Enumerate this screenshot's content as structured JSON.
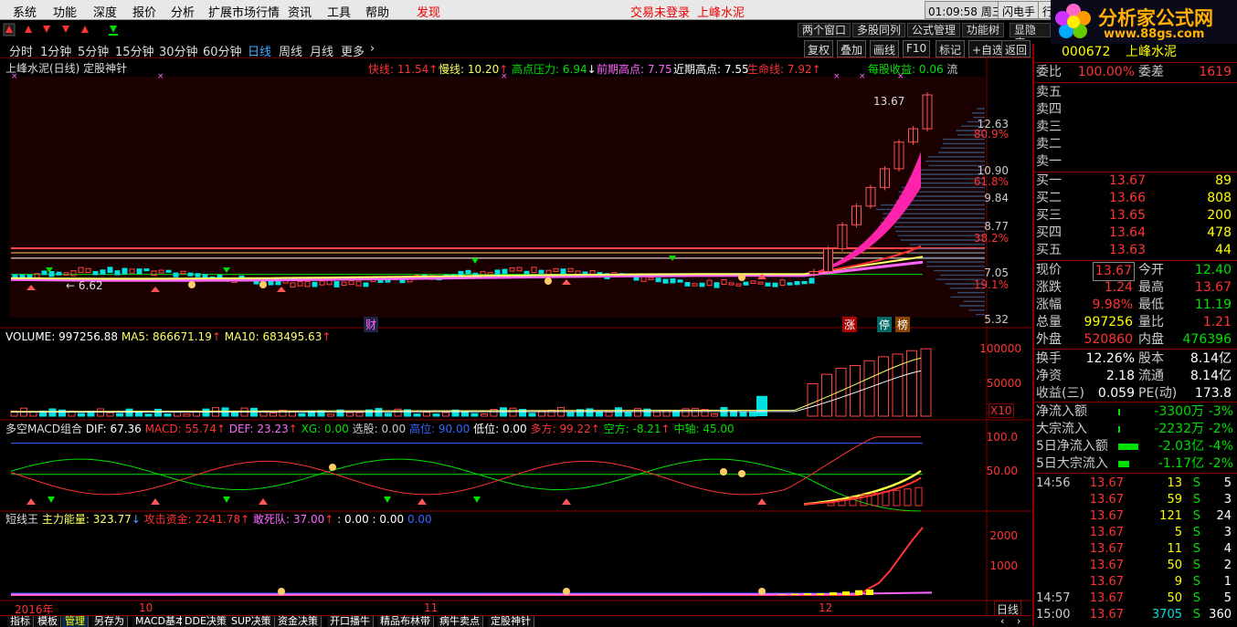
{
  "menubar": {
    "items": [
      "系统",
      "功能",
      "深度",
      "报价",
      "分析",
      "扩展市场行情",
      "资讯",
      "工具",
      "帮助"
    ],
    "discover": "发现",
    "trade_status": "交易未登录",
    "stock_name": "上峰水泥",
    "clock": "01:09:58 周三",
    "flash_order": "闪电手",
    "trade": "行"
  },
  "logo": {
    "title": "分析家公式网",
    "url": "www.88gs.com"
  },
  "toolbar2": {
    "buttons": [
      "两个窗口",
      "多股同列",
      "公式管理",
      "功能树",
      "显隐底"
    ]
  },
  "periods": {
    "items": [
      "分时",
      "1分钟",
      "5分钟",
      "15分钟",
      "30分钟",
      "60分钟",
      "日线",
      "周线",
      "月线",
      "更多"
    ],
    "active_index": 6,
    "right_buttons": [
      "复权",
      "叠加",
      "画线",
      "F10",
      "标记",
      "+自选",
      "返回"
    ]
  },
  "main_panel": {
    "title": "上峰水泥(日线) 定股神针",
    "indicators": [
      {
        "label": "快线:",
        "value": "11.54",
        "color": "#ff3333"
      },
      {
        "label": "慢线:",
        "value": "10.20",
        "color": "#ffff66"
      },
      {
        "label": "高点压力:",
        "value": "6.94",
        "color": "#00e000"
      },
      {
        "label": "前期高点:",
        "value": "7.75",
        "color": "#ff66ff"
      },
      {
        "label": "近期高点:",
        "value": "7.55",
        "color": "#ffffff"
      },
      {
        "label": "生命线:",
        "value": "7.92",
        "color": "#ff3333"
      },
      {
        "label": "每股收益:",
        "value": "0.06",
        "color": "#00e000"
      }
    ],
    "unit": "流",
    "high_label": "13.67",
    "low_label": "6.62",
    "y_ticks": [
      {
        "v": "12.63",
        "c": "#ff3333"
      },
      {
        "v": "80.9%",
        "c": "#ff3333"
      },
      {
        "v": "10.90",
        "c": "#ff3333"
      },
      {
        "v": "61.8%",
        "c": "#ff3333"
      },
      {
        "v": "9.84",
        "c": "#ff3333"
      },
      {
        "v": "8.77",
        "c": "#ff3333"
      },
      {
        "v": "38.2%",
        "c": "#ff3333"
      },
      {
        "v": "7.05",
        "c": "#ff3333"
      },
      {
        "v": "19.1%",
        "c": "#ff3333"
      },
      {
        "v": "5.32",
        "c": "#ff3333"
      }
    ],
    "markers": {
      "cai": "财",
      "zhang": "涨",
      "ting": "停",
      "ban": "榜"
    }
  },
  "volume_panel": {
    "indicators": [
      {
        "label": "VOLUME:",
        "value": "997256.88",
        "color": "#ffffff"
      },
      {
        "label": "MA5:",
        "value": "866671.19",
        "color": "#ffff66"
      },
      {
        "label": "MA10:",
        "value": "683495.63",
        "color": "#ffff66"
      }
    ],
    "y_ticks": [
      "100000",
      "50000"
    ],
    "scale": "X10"
  },
  "macd_panel": {
    "title": "多空MACD组合",
    "indicators": [
      {
        "label": "DIF:",
        "value": "67.36",
        "color": "#ffffff"
      },
      {
        "label": "MACD:",
        "value": "55.74",
        "color": "#ff3333"
      },
      {
        "label": "DEF:",
        "value": "23.23",
        "color": "#ff66ff"
      },
      {
        "label": "XG:",
        "value": "0.00",
        "color": "#00e000"
      },
      {
        "label": "选股:",
        "value": "0.00",
        "color": "#cccccc"
      },
      {
        "label": "高位:",
        "value": "90.00",
        "color": "#3366ff"
      },
      {
        "label": "低位:",
        "value": "0.00",
        "color": "#ffffff"
      },
      {
        "label": "多方:",
        "value": "99.22",
        "color": "#ff3333"
      },
      {
        "label": "空方:",
        "value": "-8.21",
        "color": "#00e000"
      },
      {
        "label": "中轴:",
        "value": "45.00",
        "color": "#00e000"
      }
    ],
    "y_ticks": [
      "100.0",
      "50.00"
    ]
  },
  "short_panel": {
    "title": "短线王",
    "indicators": [
      {
        "label": "主力能量:",
        "value": "323.77",
        "color": "#ffff66"
      },
      {
        "label": "攻击资金:",
        "value": "2241.78",
        "color": "#ff3333"
      },
      {
        "label": "敢死队:",
        "value": "37.00",
        "color": "#ff66ff"
      },
      {
        "label": ":",
        "value": "0.00 : 0.00",
        "color": "#ffffff"
      },
      {
        "label": "",
        "value": "0.00",
        "color": "#3366ff"
      }
    ],
    "y_ticks": [
      "2000",
      "1000"
    ]
  },
  "x_axis": {
    "labels": [
      "2016年",
      "10",
      "11",
      "12"
    ],
    "period": "日线"
  },
  "bottom_tabs": [
    "指标",
    "模板",
    "管理",
    "另存为",
    "MACD基本",
    "DDE决策",
    "SUP决策",
    "资金决策",
    "开口播牛",
    "精品布林带",
    "病牛卖点",
    "定股神针"
  ],
  "bottom_active": 2,
  "side": {
    "code": "000672",
    "name": "上峰水泥",
    "webi": {
      "k": "委比",
      "v": "100.00%",
      "k2": "委差",
      "v2": "1619"
    },
    "sells": [
      {
        "k": "卖五",
        "p": "",
        "q": ""
      },
      {
        "k": "卖四",
        "p": "",
        "q": ""
      },
      {
        "k": "卖三",
        "p": "",
        "q": ""
      },
      {
        "k": "卖二",
        "p": "",
        "q": ""
      },
      {
        "k": "卖一",
        "p": "",
        "q": ""
      }
    ],
    "buys": [
      {
        "k": "买一",
        "p": "13.67",
        "q": "89"
      },
      {
        "k": "买二",
        "p": "13.66",
        "q": "808"
      },
      {
        "k": "买三",
        "p": "13.65",
        "q": "200"
      },
      {
        "k": "买四",
        "p": "13.64",
        "q": "478"
      },
      {
        "k": "买五",
        "p": "13.63",
        "q": "44"
      }
    ],
    "quote": [
      {
        "k": "现价",
        "v": "13.67",
        "vc": "#ff3333",
        "k2": "今开",
        "v2": "12.40",
        "v2c": "#00e000"
      },
      {
        "k": "涨跌",
        "v": "1.24",
        "vc": "#ff3333",
        "k2": "最高",
        "v2": "13.67",
        "v2c": "#ff3333"
      },
      {
        "k": "涨幅",
        "v": "9.98%",
        "vc": "#ff3333",
        "k2": "最低",
        "v2": "11.19",
        "v2c": "#00e000"
      },
      {
        "k": "总量",
        "v": "997256",
        "vc": "#ffff00",
        "k2": "量比",
        "v2": "1.21",
        "v2c": "#ff3333"
      },
      {
        "k": "外盘",
        "v": "520860",
        "vc": "#ff3333",
        "k2": "内盘",
        "v2": "476396",
        "v2c": "#00e000"
      }
    ],
    "stats": [
      {
        "k": "换手",
        "v": "12.26%",
        "k2": "股本",
        "v2": "8.14亿"
      },
      {
        "k": "净资",
        "v": "2.18",
        "k2": "流通",
        "v2": "8.14亿"
      },
      {
        "k": "收益(三)",
        "v": "0.059",
        "k2": "PE(动)",
        "v2": "173.8"
      }
    ],
    "flows": [
      {
        "k": "净流入额",
        "v": "-3300万",
        "p": "-3%",
        "bar": 0.05
      },
      {
        "k": "大宗流入",
        "v": "-2232万",
        "p": "-2%",
        "bar": 0.04
      },
      {
        "k": "5日净流入额",
        "v": "-2.03亿",
        "p": "-4%",
        "bar": 0.9
      },
      {
        "k": "5日大宗流入",
        "v": "-1.17亿",
        "p": "-2%",
        "bar": 0.5
      }
    ],
    "ticks": [
      {
        "t": "14:56",
        "p": "13.67",
        "q": "13",
        "s": "S",
        "n": "5"
      },
      {
        "t": "",
        "p": "13.67",
        "q": "59",
        "s": "S",
        "n": "3"
      },
      {
        "t": "",
        "p": "13.67",
        "q": "121",
        "s": "S",
        "n": "24"
      },
      {
        "t": "",
        "p": "13.67",
        "q": "5",
        "s": "S",
        "n": "3"
      },
      {
        "t": "",
        "p": "13.67",
        "q": "11",
        "s": "S",
        "n": "4"
      },
      {
        "t": "",
        "p": "13.67",
        "q": "50",
        "s": "S",
        "n": "2"
      },
      {
        "t": "",
        "p": "13.67",
        "q": "9",
        "s": "S",
        "n": "1"
      },
      {
        "t": "14:57",
        "p": "13.67",
        "q": "50",
        "s": "S",
        "n": "5"
      },
      {
        "t": "15:00",
        "p": "13.67",
        "q": "3705",
        "s": "S",
        "n": "360"
      }
    ]
  },
  "chart_data": {
    "type": "candlestick",
    "recent_closes": [
      7.05,
      7.9,
      8.8,
      9.5,
      10.2,
      10.9,
      11.9,
      12.4,
      13.67
    ],
    "volume_recent_x10": [
      48000,
      62000,
      71000,
      75000,
      82000,
      88000,
      92000,
      97000,
      99726
    ],
    "attack_fund_recent": [
      200,
      400,
      800,
      1300,
      1800,
      2241.78
    ]
  }
}
